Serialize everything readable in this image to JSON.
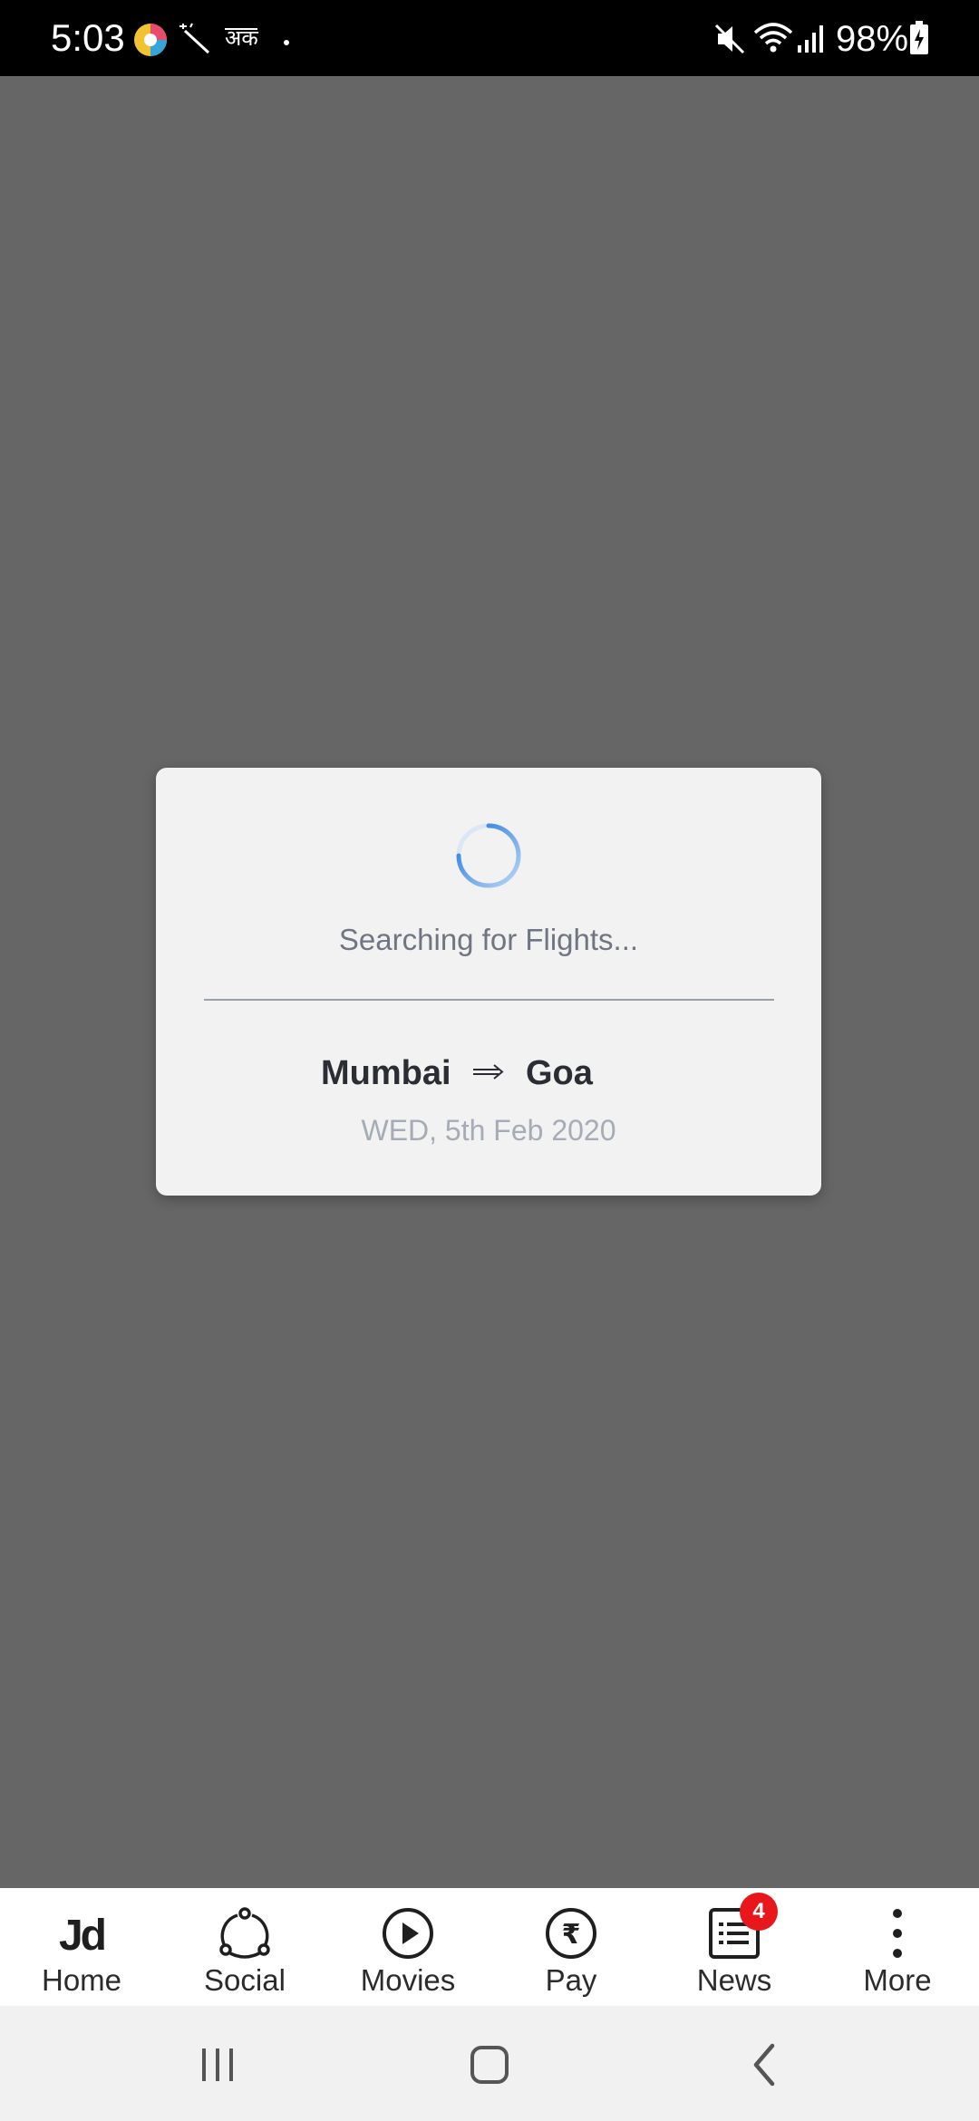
{
  "status_bar": {
    "time": "5:03",
    "battery": "98%",
    "icons": [
      "app-icon-multicolor",
      "magic-wand-icon",
      "hindi-keyboard-icon",
      "dot-icon",
      "mute-icon",
      "wifi-icon",
      "signal-icon",
      "battery-charging-icon"
    ]
  },
  "dialog": {
    "status_text": "Searching for Flights...",
    "route": {
      "from": "Mumbai",
      "to": "Goa"
    },
    "date": "WED, 5th Feb 2020"
  },
  "bottom_nav": {
    "items": [
      {
        "label": "Home",
        "icon": "jd-logo-icon"
      },
      {
        "label": "Social",
        "icon": "social-network-icon"
      },
      {
        "label": "Movies",
        "icon": "play-icon"
      },
      {
        "label": "Pay",
        "icon": "rupee-icon"
      },
      {
        "label": "News",
        "icon": "news-list-icon",
        "badge": "4"
      },
      {
        "label": "More",
        "icon": "more-vertical-icon"
      }
    ]
  },
  "colors": {
    "overlay": "#666666",
    "dialog_bg": "#f2f2f3",
    "spinner": "#2d7de0",
    "badge": "#e8171c"
  }
}
